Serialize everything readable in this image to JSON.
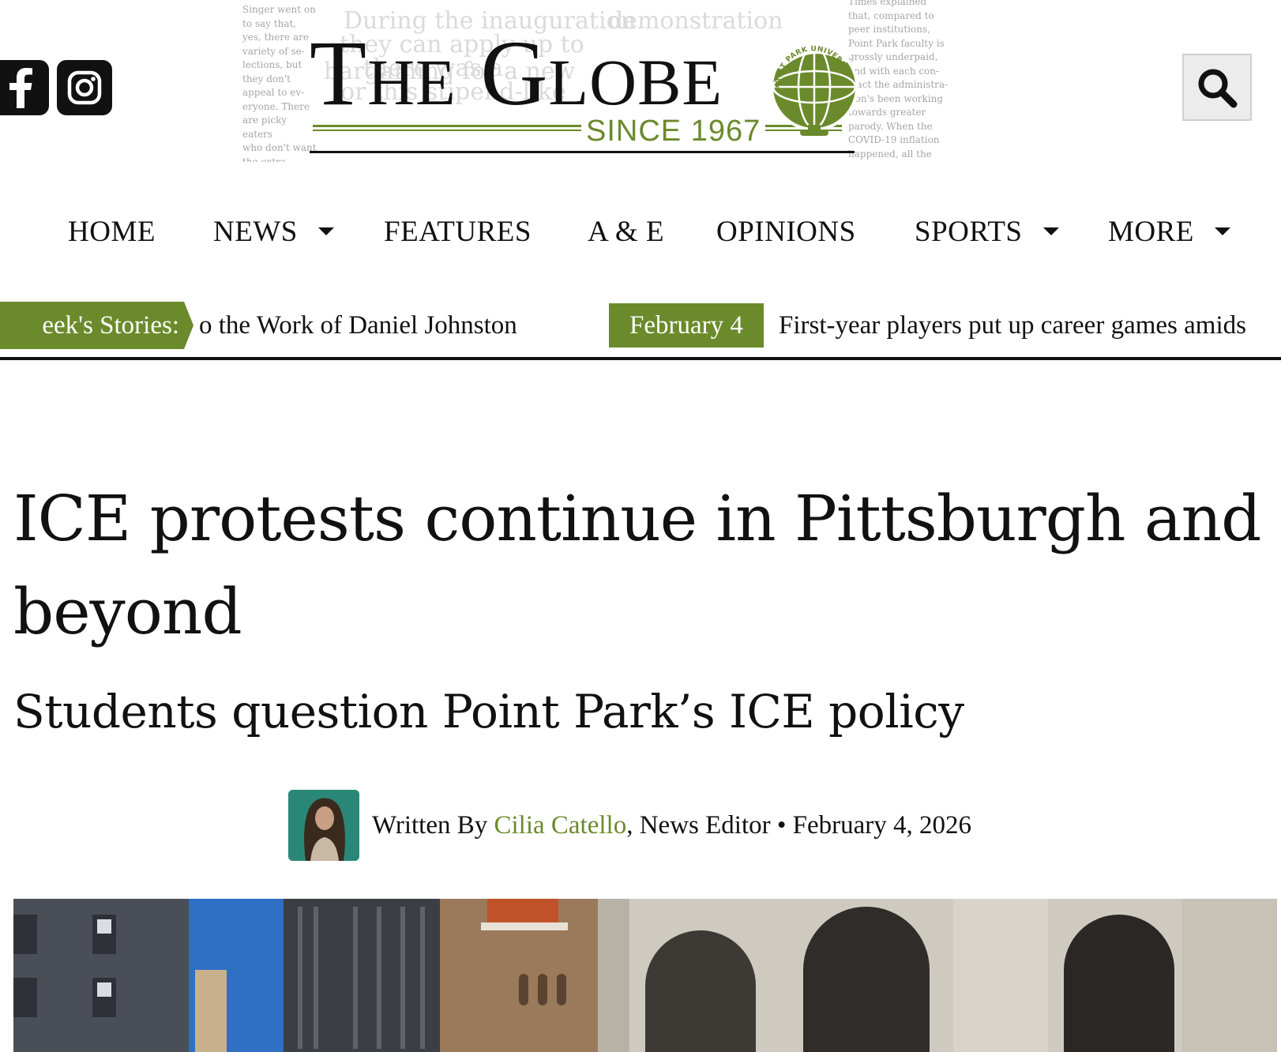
{
  "header": {
    "masthead": {
      "title": "The Globe",
      "since": "SINCE 1967",
      "seal_text": "POINT PARK UNIVERSITY",
      "background_clippings": {
        "left_column": [
          "Singer went on",
          "to say that,",
          "yes, there are",
          "variety of se-",
          "lections, but",
          "they don't",
          "appeal to ev-",
          "eryone. There",
          "are picky eaters",
          "who don't want",
          "the extra sauces"
        ],
        "right_column": [
          "Times explained",
          "that, compared to",
          "peer institutions,",
          "Point Park faculty is",
          "grossly underpaid,",
          "and with each con-",
          "tract the administra-",
          "tion's been working",
          "towards greater",
          "parody. When the",
          "COVID-19 inflation",
          "happened, all the"
        ],
        "middle_lines": [
          "During the inauguration",
          "they can apply up to",
          "there was a",
          "demonstration",
          "for this stipend-like",
          "bargaining for a new"
        ]
      }
    },
    "social": {
      "facebook_icon": "facebook-icon",
      "instagram_icon": "instagram-icon"
    },
    "search_icon": "search-icon"
  },
  "nav": {
    "items": [
      {
        "label": "HOME",
        "has_dropdown": false
      },
      {
        "label": "NEWS",
        "has_dropdown": true
      },
      {
        "label": "FEATURES",
        "has_dropdown": false
      },
      {
        "label": "A & E",
        "has_dropdown": false
      },
      {
        "label": "OPINIONS",
        "has_dropdown": false
      },
      {
        "label": "SPORTS",
        "has_dropdown": true
      },
      {
        "label": "MORE",
        "has_dropdown": true
      }
    ]
  },
  "ticker": {
    "label": "eek's Stories:",
    "stories": [
      {
        "text": "o the Work of Daniel Johnston"
      },
      {
        "date": "February 4",
        "text": "First-year players put up career games amids"
      }
    ]
  },
  "article": {
    "headline": "ICE protests continue in Pittsburgh and beyond",
    "subheadline": "Students question Point Park’s ICE policy",
    "byline": {
      "prefix": "Written By ",
      "author": "Cilia Catello",
      "role": ", News Editor",
      "separator": " • ",
      "date": "February 4, 2026"
    }
  },
  "colors": {
    "brand_green": "#6b8a2c",
    "text": "#111111",
    "search_bg": "#ececec"
  }
}
